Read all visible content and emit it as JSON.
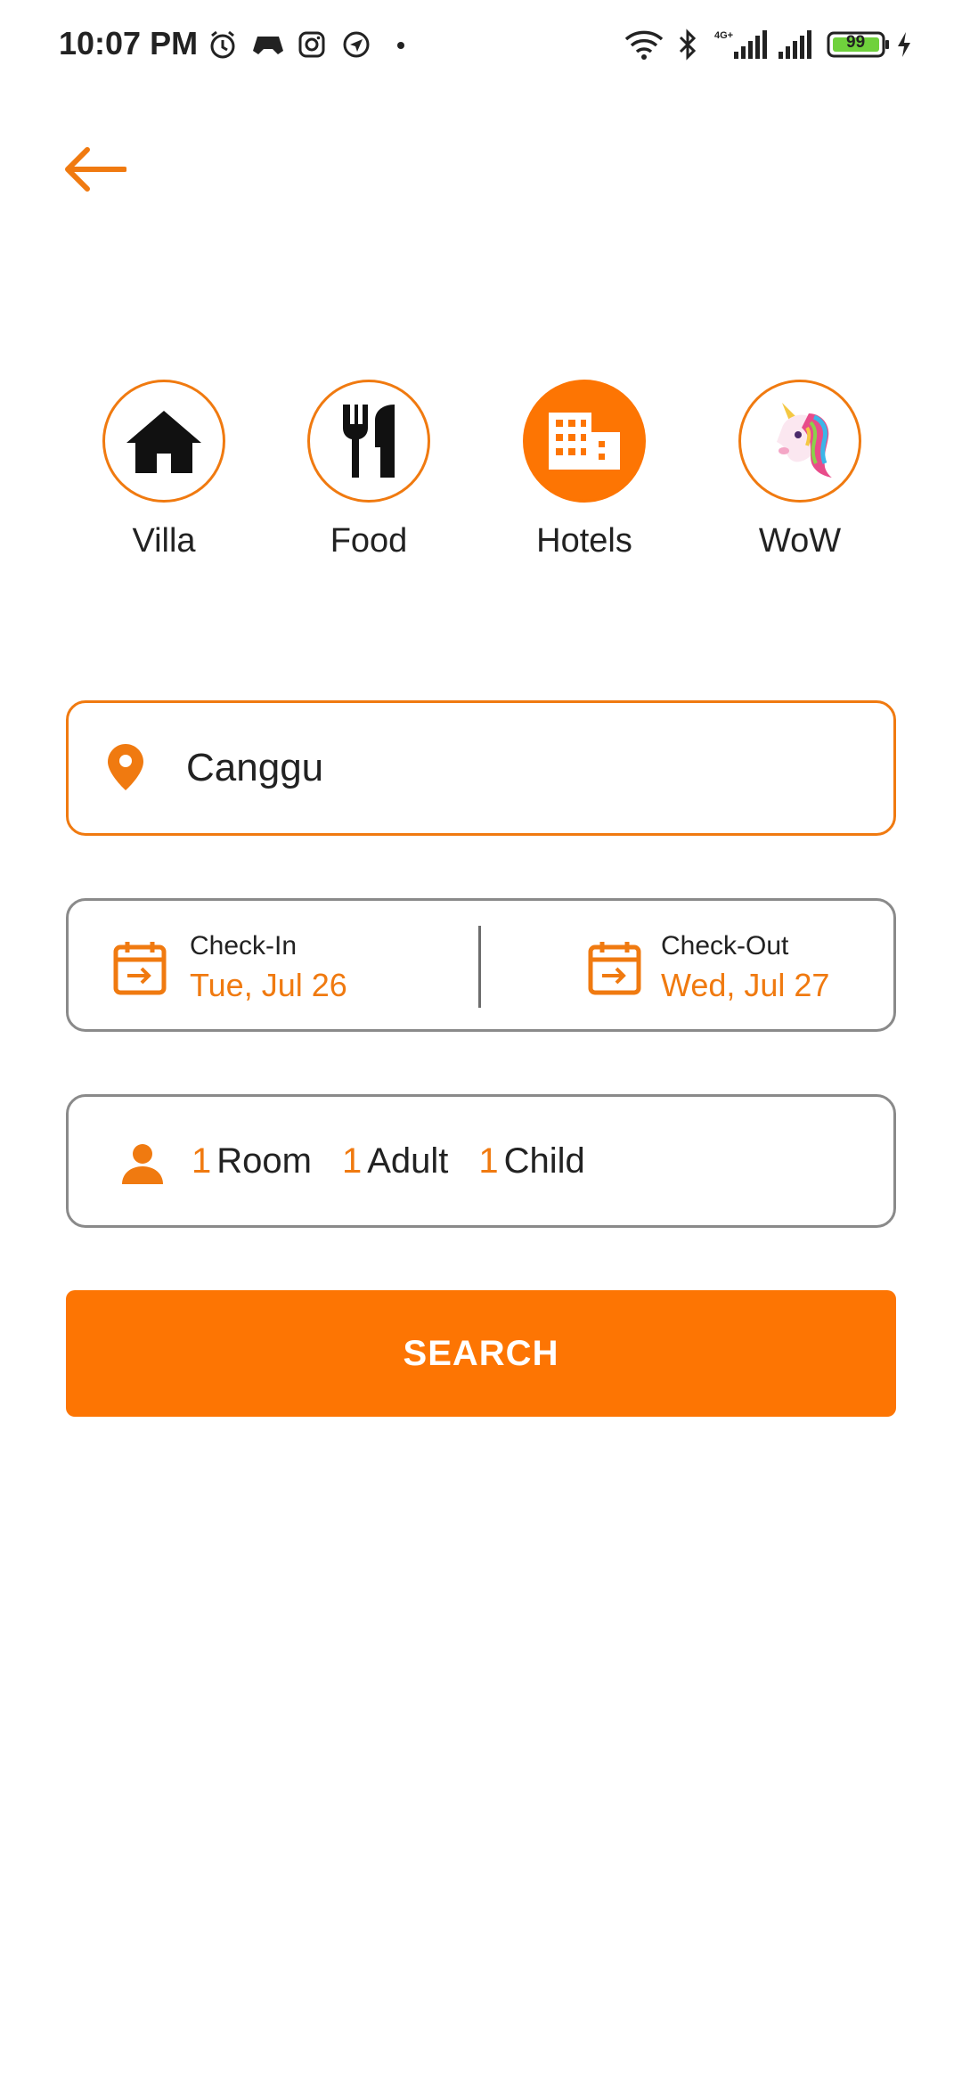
{
  "status_bar": {
    "time": "10:07 PM",
    "battery": "99",
    "network": "4G+",
    "icons_left": [
      "alarm-icon",
      "game-controller-icon",
      "instagram-icon",
      "location-off-icon"
    ],
    "icons_right": [
      "wifi-icon",
      "bluetooth-icon",
      "signal-icon",
      "signal-icon",
      "battery-icon",
      "charging-icon"
    ]
  },
  "header": {
    "back_icon": "arrow-left-icon"
  },
  "categories": [
    {
      "label": "Villa",
      "icon": "house-icon",
      "active": false
    },
    {
      "label": "Food",
      "icon": "fork-knife-icon",
      "active": false
    },
    {
      "label": "Hotels",
      "icon": "building-icon",
      "active": true
    },
    {
      "label": "WoW",
      "icon": "unicorn-icon",
      "active": false
    }
  ],
  "location": {
    "value": "Canggu",
    "icon": "map-pin-icon"
  },
  "dates": {
    "check_in": {
      "title": "Check-In",
      "value": "Tue, Jul 26"
    },
    "check_out": {
      "title": "Check-Out",
      "value": "Wed, Jul 27"
    }
  },
  "guests": {
    "rooms": {
      "count": "1",
      "label": "Room"
    },
    "adults": {
      "count": "1",
      "label": "Adult"
    },
    "children": {
      "count": "1",
      "label": "Child"
    }
  },
  "search_button": {
    "label": "SEARCH"
  },
  "colors": {
    "accent": "#fd7503",
    "border": "#8a8a8a",
    "text": "#222222"
  }
}
